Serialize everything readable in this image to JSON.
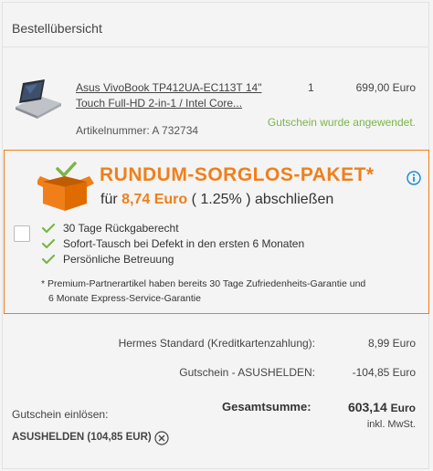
{
  "header": {
    "title": "Bestellübersicht"
  },
  "item": {
    "name_line1": "Asus VivoBook TP412UA-EC113T 14\"",
    "name_line2": "Touch Full-HD 2-in-1 / Intel Core...",
    "quantity": "1",
    "price": "699,00 Euro",
    "voucher_status": "Gutschein wurde angewendet.",
    "article_number": "Artikelnummer: A 732734"
  },
  "promo": {
    "title": "RUNDUM-SORGLOS-PAKET*",
    "sub_prefix": "für",
    "sub_price": "8,74 Euro",
    "sub_percent": "( 1.25% )",
    "sub_suffix": "abschließen",
    "benefits": [
      "30 Tage Rückgaberecht",
      "Sofort-Tausch bei Defekt in den ersten 6 Monaten",
      "Persönliche Betreuung"
    ],
    "note_line1": "* Premium-Partnerartikel haben bereits 30 Tage Zufriedenheits-Garantie und",
    "note_line2": "6 Monate Express-Service-Garantie",
    "accent_color": "#f07f1a",
    "check_color": "#7ab648"
  },
  "summary": {
    "shipping_label": "Hermes Standard (Kreditkartenzahlung):",
    "shipping_value": "8,99 Euro",
    "voucher_label": "Gutschein - ASUSHELDEN:",
    "voucher_value": "-104,85 Euro",
    "redeem_label": "Gutschein einlösen:",
    "voucher_code": "ASUSHELDEN (104,85 EUR)",
    "total_label": "Gesamtsumme:",
    "total_value": "603,14",
    "total_currency": "Euro",
    "tax_note": "inkl. MwSt."
  }
}
